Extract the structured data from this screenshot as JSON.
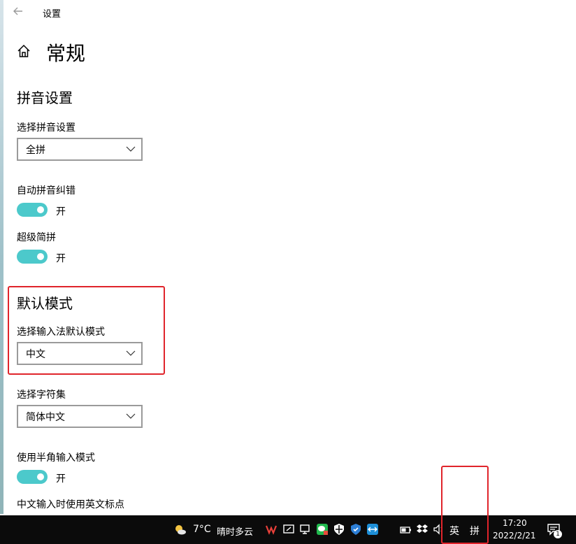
{
  "window": {
    "title": "设置"
  },
  "page": {
    "title": "常规"
  },
  "pinyin_section": {
    "heading": "拼音设置",
    "select_label": "选择拼音设置",
    "select_value": "全拼",
    "autocorrect_label": "自动拼音纠错",
    "autocorrect_state": "开",
    "super_jianpin_label": "超级简拼",
    "super_jianpin_state": "开"
  },
  "default_mode_section": {
    "heading": "默认模式",
    "select_label": "选择输入法默认模式",
    "select_value": "中文"
  },
  "charset": {
    "label": "选择字符集",
    "value": "简体中文"
  },
  "halfwidth": {
    "label": "使用半角输入模式",
    "state": "开"
  },
  "english_punct": {
    "label": "中文输入时使用英文标点"
  },
  "taskbar": {
    "weather_temp": "7°C",
    "weather_desc": "晴时多云",
    "ime_lang": "英",
    "ime_mode": "拼",
    "time": "17:20",
    "date": "2022/2/21",
    "notification_count": "1"
  },
  "colors": {
    "accent_toggle": "#4cc9cb",
    "highlight_box": "#e0242b",
    "taskbar_bg": "#0b0b0b"
  },
  "icons": [
    "back-arrow-icon",
    "home-icon",
    "chevron-down-icon",
    "weather-icon",
    "wps-icon",
    "network-icon",
    "wechat-icon",
    "security-shield-icon",
    "defender-icon",
    "teamviewer-icon",
    "battery-icon",
    "dropbox-icon",
    "volume-icon",
    "notification-icon"
  ]
}
